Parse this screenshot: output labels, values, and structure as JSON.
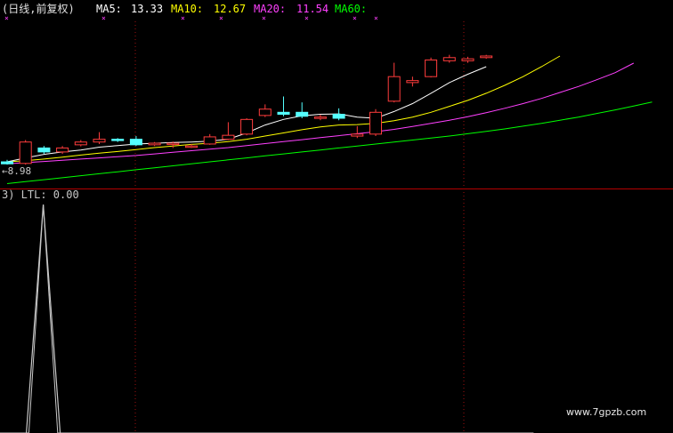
{
  "header": {
    "period": "(日线,前复权)",
    "ma5_label": "MA5:",
    "ma5_value": "13.33",
    "ma10_label": "MA10:",
    "ma10_value": "12.67",
    "ma20_label": "MA20:",
    "ma20_value": "11.54",
    "ma60_label": "MA60:"
  },
  "colors": {
    "ma5": "#ffffff",
    "ma10": "#ffff00",
    "ma20": "#ff40ff",
    "ma60": "#00ff00",
    "up": "#ff3c3c",
    "down": "#54ffff",
    "divider": "#b40000",
    "indicator_line": "#c8c8c8"
  },
  "price_panel": {
    "low_marker": "←8.98"
  },
  "indicator_panel": {
    "label": "3) LTL: 0.00"
  },
  "watermark": "www.7gpzb.com",
  "chart_data": [
    {
      "type": "candlestick",
      "title": "",
      "candles": [
        {
          "o": 9.05,
          "c": 9.0,
          "h": 9.1,
          "l": 8.98
        },
        {
          "o": 9.01,
          "c": 9.55,
          "h": 9.6,
          "l": 8.98
        },
        {
          "o": 9.4,
          "c": 9.3,
          "h": 9.45,
          "l": 9.25
        },
        {
          "o": 9.3,
          "c": 9.4,
          "h": 9.45,
          "l": 9.25
        },
        {
          "o": 9.48,
          "c": 9.55,
          "h": 9.6,
          "l": 9.44
        },
        {
          "o": 9.55,
          "c": 9.62,
          "h": 9.8,
          "l": 9.5
        },
        {
          "o": 9.62,
          "c": 9.6,
          "h": 9.65,
          "l": 9.55
        },
        {
          "o": 9.62,
          "c": 9.48,
          "h": 9.7,
          "l": 9.45
        },
        {
          "o": 9.48,
          "c": 9.52,
          "h": 9.55,
          "l": 9.45
        },
        {
          "o": 9.5,
          "c": 9.52,
          "h": 9.56,
          "l": 9.4
        },
        {
          "o": 9.45,
          "c": 9.45,
          "h": 9.5,
          "l": 9.4
        },
        {
          "o": 9.5,
          "c": 9.68,
          "h": 9.75,
          "l": 9.48
        },
        {
          "o": 9.62,
          "c": 9.72,
          "h": 10.05,
          "l": 9.6
        },
        {
          "o": 9.75,
          "c": 10.12,
          "h": 10.15,
          "l": 9.72
        },
        {
          "o": 10.22,
          "c": 10.38,
          "h": 10.5,
          "l": 10.18
        },
        {
          "o": 10.3,
          "c": 10.25,
          "h": 10.7,
          "l": 10.2
        },
        {
          "o": 10.3,
          "c": 10.2,
          "h": 10.55,
          "l": 10.15
        },
        {
          "o": 10.15,
          "c": 10.18,
          "h": 10.24,
          "l": 10.1
        },
        {
          "o": 10.25,
          "c": 10.15,
          "h": 10.4,
          "l": 10.1
        },
        {
          "o": 9.7,
          "c": 9.75,
          "h": 9.95,
          "l": 9.65
        },
        {
          "o": 9.75,
          "c": 10.3,
          "h": 10.38,
          "l": 9.7
        },
        {
          "o": 10.58,
          "c": 11.2,
          "h": 11.55,
          "l": 10.55
        },
        {
          "o": 11.05,
          "c": 11.1,
          "h": 11.2,
          "l": 10.95
        },
        {
          "o": 11.2,
          "c": 11.62,
          "h": 11.68,
          "l": 11.18
        },
        {
          "o": 11.6,
          "c": 11.68,
          "h": 11.75,
          "l": 11.55
        },
        {
          "o": 11.6,
          "c": 11.65,
          "h": 11.7,
          "l": 11.55
        },
        {
          "o": 11.68,
          "c": 11.72,
          "h": 11.75,
          "l": 11.65
        }
      ],
      "ma5": [
        9.05,
        9.15,
        9.24,
        9.3,
        9.35,
        9.42,
        9.46,
        9.5,
        9.52,
        9.54,
        9.55,
        9.57,
        9.62,
        9.78,
        9.98,
        10.12,
        10.21,
        10.25,
        10.26,
        10.18,
        10.15,
        10.32,
        10.52,
        10.78,
        11.05,
        11.26,
        11.45
      ],
      "ma10": [
        9.05,
        9.08,
        9.12,
        9.17,
        9.22,
        9.27,
        9.31,
        9.36,
        9.41,
        9.45,
        9.49,
        9.52,
        9.56,
        9.62,
        9.7,
        9.78,
        9.86,
        9.93,
        9.98,
        9.99,
        10.02,
        10.09,
        10.18,
        10.3,
        10.45,
        10.6,
        10.78,
        10.98,
        11.2,
        11.45,
        11.72
      ],
      "ma20": [
        9.0,
        9.03,
        9.06,
        9.09,
        9.12,
        9.15,
        9.18,
        9.21,
        9.25,
        9.29,
        9.33,
        9.37,
        9.41,
        9.46,
        9.51,
        9.56,
        9.61,
        9.66,
        9.71,
        9.76,
        9.81,
        9.87,
        9.94,
        10.02,
        10.1,
        10.19,
        10.29,
        10.4,
        10.52,
        10.65,
        10.8,
        10.95,
        11.12,
        11.3,
        11.54
      ],
      "ma60": [
        8.5,
        8.55,
        8.6,
        8.65,
        8.7,
        8.75,
        8.8,
        8.85,
        8.9,
        8.95,
        9.0,
        9.05,
        9.1,
        9.15,
        9.2,
        9.25,
        9.3,
        9.35,
        9.4,
        9.45,
        9.5,
        9.55,
        9.6,
        9.65,
        9.7,
        9.76,
        9.82,
        9.88,
        9.95,
        10.02,
        10.1,
        10.18,
        10.27,
        10.36,
        10.46,
        10.56
      ],
      "ylim": [
        8.4,
        12.55
      ]
    },
    {
      "type": "line",
      "title": "",
      "series": [
        {
          "values": [
            0,
            0,
            0,
            1,
            0,
            0,
            0,
            0,
            0,
            0,
            0,
            0,
            0,
            0,
            0,
            0,
            0,
            0,
            0,
            0,
            0,
            0,
            0,
            0,
            0,
            0,
            0,
            0,
            0,
            0,
            0,
            0,
            0,
            0,
            0,
            0,
            0,
            0
          ]
        }
      ],
      "ylim": [
        0,
        1
      ]
    }
  ]
}
